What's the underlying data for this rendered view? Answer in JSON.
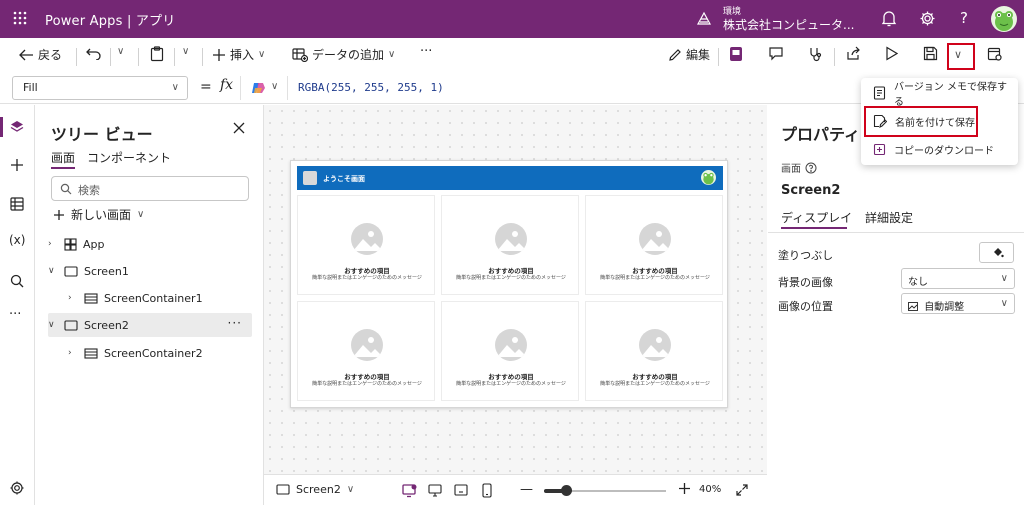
{
  "topbar": {
    "app_title": "Power Apps | アプリ",
    "env_label": "環境",
    "env_name": "株式会社コンピュータ..."
  },
  "commandbar": {
    "back": "戻る",
    "insert": "挿入",
    "add_data": "データの追加",
    "more": "···",
    "edit": "編集"
  },
  "formulabar": {
    "property": "Fill",
    "equals": "=",
    "fx": "fx",
    "formula": "RGBA(255, 255, 255, 1)"
  },
  "tree": {
    "title": "ツリー ビュー",
    "tabs": [
      "画面",
      "コンポーネント"
    ],
    "search_placeholder": "検索",
    "new_screen": "新しい画面",
    "items": [
      {
        "label": "App"
      },
      {
        "label": "Screen1"
      },
      {
        "label": "ScreenContainer1"
      },
      {
        "label": "Screen2"
      },
      {
        "label": "ScreenContainer2"
      }
    ],
    "more": "···"
  },
  "canvas": {
    "header_title": "ようこそ画面",
    "card_title": "おすすめの項目",
    "card_desc": "簡単な説明またはエンゲージのためのメッセージ"
  },
  "statusbar": {
    "screen": "Screen2",
    "zoom": "40%",
    "zoom_level": 0.18
  },
  "props": {
    "title": "プロパティ",
    "type": "画面",
    "screen_name": "Screen2",
    "tabs": [
      "ディスプレイ",
      "詳細設定"
    ],
    "fill_label": "塗りつぶし",
    "bg_image_label": "背景の画像",
    "bg_image_value": "なし",
    "image_pos_label": "画像の位置",
    "image_pos_value": "自動調整"
  },
  "savemenu": {
    "items": [
      {
        "label": "バージョン メモで保存する"
      },
      {
        "label": "名前を付けて保存"
      },
      {
        "label": "コピーのダウンロード"
      }
    ]
  },
  "colors": {
    "brand": "#742774",
    "app_header": "#0f6cbd",
    "highlight": "#d0021b"
  }
}
